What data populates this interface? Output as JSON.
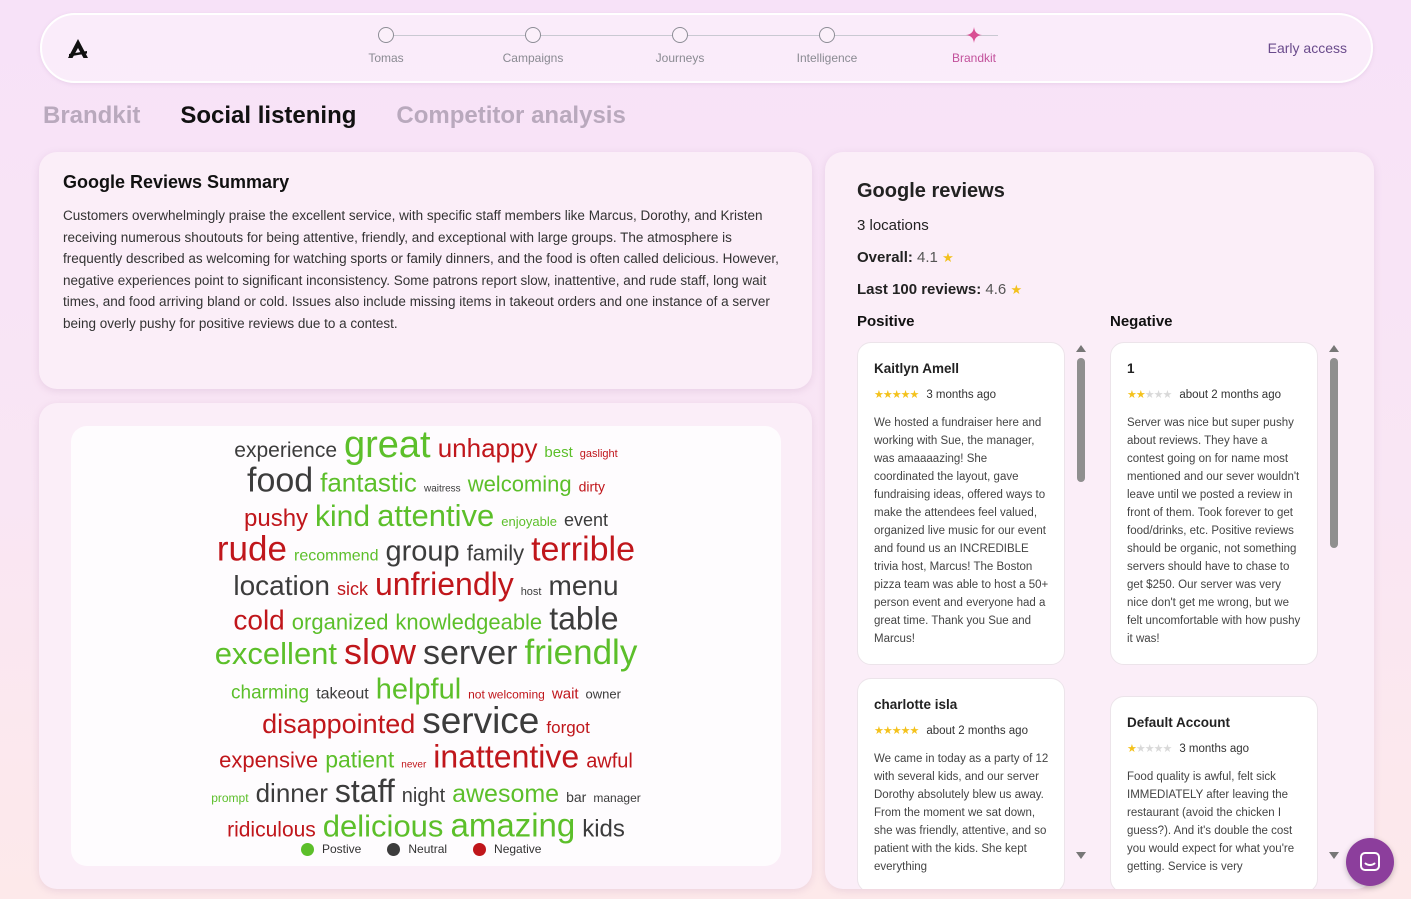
{
  "nav": {
    "steps": [
      {
        "label": "Tomas",
        "icon": "circle-icon",
        "active": false
      },
      {
        "label": "Campaigns",
        "icon": "circle-icon",
        "active": false
      },
      {
        "label": "Journeys",
        "icon": "circle-icon",
        "active": false
      },
      {
        "label": "Intelligence",
        "icon": "circle-icon",
        "active": false
      },
      {
        "label": "Brandkit",
        "icon": "sparkle-icon",
        "active": true
      }
    ],
    "early_access": "Early access"
  },
  "tabs": [
    {
      "label": "Brandkit",
      "active": false
    },
    {
      "label": "Social listening",
      "active": true
    },
    {
      "label": "Competitor analysis",
      "active": false
    }
  ],
  "summary": {
    "title": "Google Reviews Summary",
    "text": "Customers overwhelmingly praise the excellent service, with specific staff members like Marcus, Dorothy, and Kristen receiving numerous shoutouts for being attentive, friendly, and exceptional with large groups. The atmosphere is frequently described as welcoming for watching sports or family dinners, and the food is often called delicious. However, negative experiences point to significant inconsistency. Some patrons report slow, inattentive, and rude staff, long wait times, and food arriving bland or cold. Issues also include missing items in takeout orders and one instance of a server being overly pushy for positive reviews due to a contest."
  },
  "wordcloud": {
    "colors": {
      "positive": "#5cbf2a",
      "neutral": "#3c3c3c",
      "negative": "#c0161b"
    },
    "legend": {
      "positive": "Postive",
      "neutral": "Neutral",
      "negative": "Negative"
    },
    "lines": [
      [
        [
          "experience",
          "neutral",
          21
        ],
        [
          "great",
          "positive",
          38
        ],
        [
          "unhappy",
          "negative",
          26
        ],
        [
          "best",
          "positive",
          15
        ],
        [
          "gaslight",
          "negative",
          11
        ]
      ],
      [
        [
          "food",
          "neutral",
          34
        ],
        [
          "fantastic",
          "positive",
          26
        ],
        [
          "waitress",
          "neutral",
          10
        ],
        [
          "welcoming",
          "positive",
          22
        ],
        [
          "dirty",
          "negative",
          14
        ]
      ],
      [
        [
          "pushy",
          "negative",
          24
        ],
        [
          "kind",
          "positive",
          30
        ],
        [
          "attentive",
          "positive",
          31
        ],
        [
          "enjoyable",
          "positive",
          13
        ],
        [
          "event",
          "neutral",
          18
        ]
      ],
      [
        [
          "rude",
          "negative",
          35
        ],
        [
          "recommend",
          "positive",
          16
        ],
        [
          "group",
          "neutral",
          29
        ],
        [
          "family",
          "neutral",
          22
        ],
        [
          "terrible",
          "negative",
          34
        ]
      ],
      [
        [
          "location",
          "neutral",
          28
        ],
        [
          "sick",
          "negative",
          18
        ],
        [
          "unfriendly",
          "negative",
          32
        ],
        [
          "host",
          "neutral",
          11
        ],
        [
          "menu",
          "neutral",
          28
        ]
      ],
      [
        [
          "cold",
          "negative",
          28
        ],
        [
          "organized",
          "positive",
          22
        ],
        [
          "knowledgeable",
          "positive",
          22
        ],
        [
          "table",
          "neutral",
          32
        ]
      ],
      [
        [
          "excellent",
          "positive",
          31
        ],
        [
          "slow",
          "negative",
          36
        ],
        [
          "server",
          "neutral",
          34
        ],
        [
          "friendly",
          "positive",
          35
        ]
      ],
      [
        [
          "charming",
          "positive",
          19
        ],
        [
          "takeout",
          "neutral",
          16
        ],
        [
          "helpful",
          "positive",
          29
        ],
        [
          "not welcoming",
          "negative",
          12
        ],
        [
          "wait",
          "negative",
          15
        ],
        [
          "owner",
          "neutral",
          13
        ]
      ],
      [
        [
          "disappointed",
          "negative",
          27
        ],
        [
          "service",
          "neutral",
          37
        ],
        [
          "forgot",
          "negative",
          17
        ]
      ],
      [
        [
          "expensive",
          "negative",
          22
        ],
        [
          "patient",
          "positive",
          23
        ],
        [
          "never",
          "negative",
          10
        ],
        [
          "inattentive",
          "negative",
          32
        ],
        [
          "awful",
          "negative",
          20
        ]
      ],
      [
        [
          "prompt",
          "positive",
          12
        ],
        [
          "dinner",
          "neutral",
          26
        ],
        [
          "staff",
          "neutral",
          32
        ],
        [
          "night",
          "neutral",
          20
        ],
        [
          "awesome",
          "positive",
          25
        ],
        [
          "bar",
          "neutral",
          14
        ],
        [
          "manager",
          "neutral",
          12
        ]
      ],
      [
        [
          "ridiculous",
          "negative",
          21
        ],
        [
          "delicious",
          "positive",
          31
        ],
        [
          "amazing",
          "positive",
          33
        ],
        [
          "kids",
          "neutral",
          24
        ]
      ]
    ]
  },
  "reviews": {
    "title": "Google reviews",
    "locations": "3 locations",
    "overall_label": "Overall:",
    "overall_value": "4.1",
    "last100_label": "Last 100 reviews:",
    "last100_value": "4.6",
    "positive_title": "Positive",
    "negative_title": "Negative",
    "positive": [
      {
        "name": "Kaitlyn Amell",
        "stars": 5,
        "time": "3 months ago",
        "text": "We hosted a fundraiser here and working with Sue, the manager, was amaaaazing! She coordinated the layout, gave fundraising ideas, offered ways to make the attendees feel valued, organized live music for our event and found us an INCREDIBLE trivia host, Marcus! The Boston pizza team was able to host a 50+ person event and everyone had a great time. Thank you Sue and Marcus!"
      },
      {
        "name": "charlotte isla",
        "stars": 5,
        "time": "about 2 months ago",
        "text": "We came in today as a party of 12 with several kids, and our server Dorothy absolutely blew us away. From the moment we sat down, she was friendly, attentive, and so patient with the kids. She kept everything"
      }
    ],
    "negative": [
      {
        "name": "1",
        "stars": 2,
        "time": "about 2 months ago",
        "text": "Server was nice but super pushy about reviews. They have a contest going on for name most mentioned and our sever wouldn't leave until we posted a review in front of them. Took forever to get food/drinks, etc. Positive reviews should be organic, not something servers should have to chase to get $250. Our server was very nice don't get me wrong, but we felt uncomfortable with how pushy it was!"
      },
      {
        "name": "Default Account",
        "stars": 1,
        "time": "3 months ago",
        "text": "Food quality is awful, felt sick IMMEDIATELY after leaving the restaurant (avoid the chicken I guess?). And it's double the cost you would expect for what you're getting. Service is very"
      }
    ]
  }
}
